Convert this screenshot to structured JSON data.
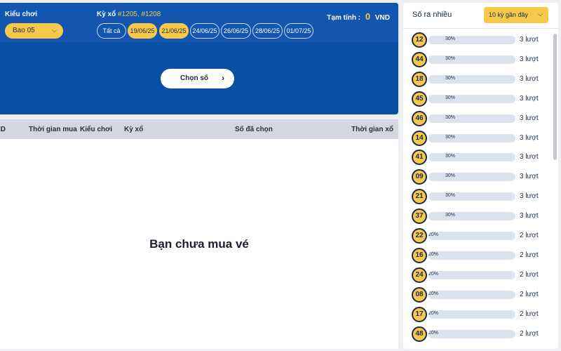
{
  "filters": {
    "play_type_label": "Kiểu chơi",
    "play_type_value": "Bao 05",
    "draw_label": "Kỳ xổ",
    "draw_numbers": "#1205, #1208",
    "dates": [
      {
        "label": "Tất cả",
        "active": false
      },
      {
        "label": "19/06/25",
        "active": true
      },
      {
        "label": "21/06/25",
        "active": true
      },
      {
        "label": "24/06/25",
        "active": false
      },
      {
        "label": "26/06/25",
        "active": false
      },
      {
        "label": "28/06/25",
        "active": false
      },
      {
        "label": "01/07/25",
        "active": false
      }
    ],
    "total_label": "Tạm tính :",
    "total_amount": "0",
    "currency": "VND"
  },
  "pick_button": {
    "label": "Chọn số"
  },
  "table": {
    "headers": [
      "ID",
      "Thời gian mua",
      "Kiểu chơi",
      "Kỳ xổ",
      "Số đã chọn",
      "Thời gian xổ"
    ],
    "empty_message": "Bạn chưa mua vé"
  },
  "frequency": {
    "title": "Số ra nhiều",
    "range_select": "10 kỳ gần đây",
    "rows": [
      {
        "number": "12",
        "percent": 30,
        "percent_label": "30%",
        "count": "3 lượt"
      },
      {
        "number": "44",
        "percent": 30,
        "percent_label": "30%",
        "count": "3 lượt"
      },
      {
        "number": "18",
        "percent": 30,
        "percent_label": "30%",
        "count": "3 lượt"
      },
      {
        "number": "45",
        "percent": 30,
        "percent_label": "30%",
        "count": "3 lượt"
      },
      {
        "number": "46",
        "percent": 30,
        "percent_label": "30%",
        "count": "3 lượt"
      },
      {
        "number": "14",
        "percent": 30,
        "percent_label": "30%",
        "count": "3 lượt"
      },
      {
        "number": "41",
        "percent": 30,
        "percent_label": "30%",
        "count": "3 lượt"
      },
      {
        "number": "09",
        "percent": 30,
        "percent_label": "30%",
        "count": "3 lượt"
      },
      {
        "number": "21",
        "percent": 30,
        "percent_label": "30%",
        "count": "3 lượt"
      },
      {
        "number": "37",
        "percent": 30,
        "percent_label": "30%",
        "count": "3 lượt"
      },
      {
        "number": "22",
        "percent": 20,
        "percent_label": "20%",
        "count": "2 lượt"
      },
      {
        "number": "16",
        "percent": 20,
        "percent_label": "20%",
        "count": "2 lượt"
      },
      {
        "number": "24",
        "percent": 20,
        "percent_label": "20%",
        "count": "2 lượt"
      },
      {
        "number": "08",
        "percent": 20,
        "percent_label": "20%",
        "count": "2 lượt"
      },
      {
        "number": "17",
        "percent": 20,
        "percent_label": "20%",
        "count": "2 lượt"
      },
      {
        "number": "48",
        "percent": 20,
        "percent_label": "20%",
        "count": "2 lượt"
      }
    ]
  },
  "colors": {
    "primary_blue": "#0a4fa6",
    "accent_yellow": "#f6c94a",
    "navy": "#1b2a4a"
  }
}
